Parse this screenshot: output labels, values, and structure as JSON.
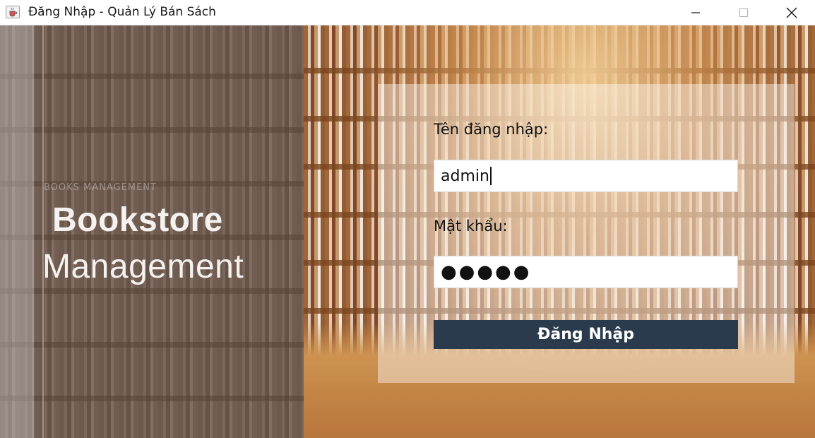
{
  "window": {
    "title": "Đăng Nhập - Quản Lý Bán Sách",
    "icon": "java-cup-icon"
  },
  "branding": {
    "watermark": "BOOKS MANAGEMENT",
    "line1": "Bookstore",
    "line2": "Management"
  },
  "login": {
    "username_label": "Tên đăng nhập:",
    "username_value": "admin",
    "password_label": "Mật khẩu:",
    "password_masked": "●●●●●",
    "submit_label": "Đăng Nhập"
  },
  "colors": {
    "button_bg": "#2b3b4d",
    "button_text": "#ffffff",
    "panel_bg": "rgba(255,255,255,0.42)"
  }
}
